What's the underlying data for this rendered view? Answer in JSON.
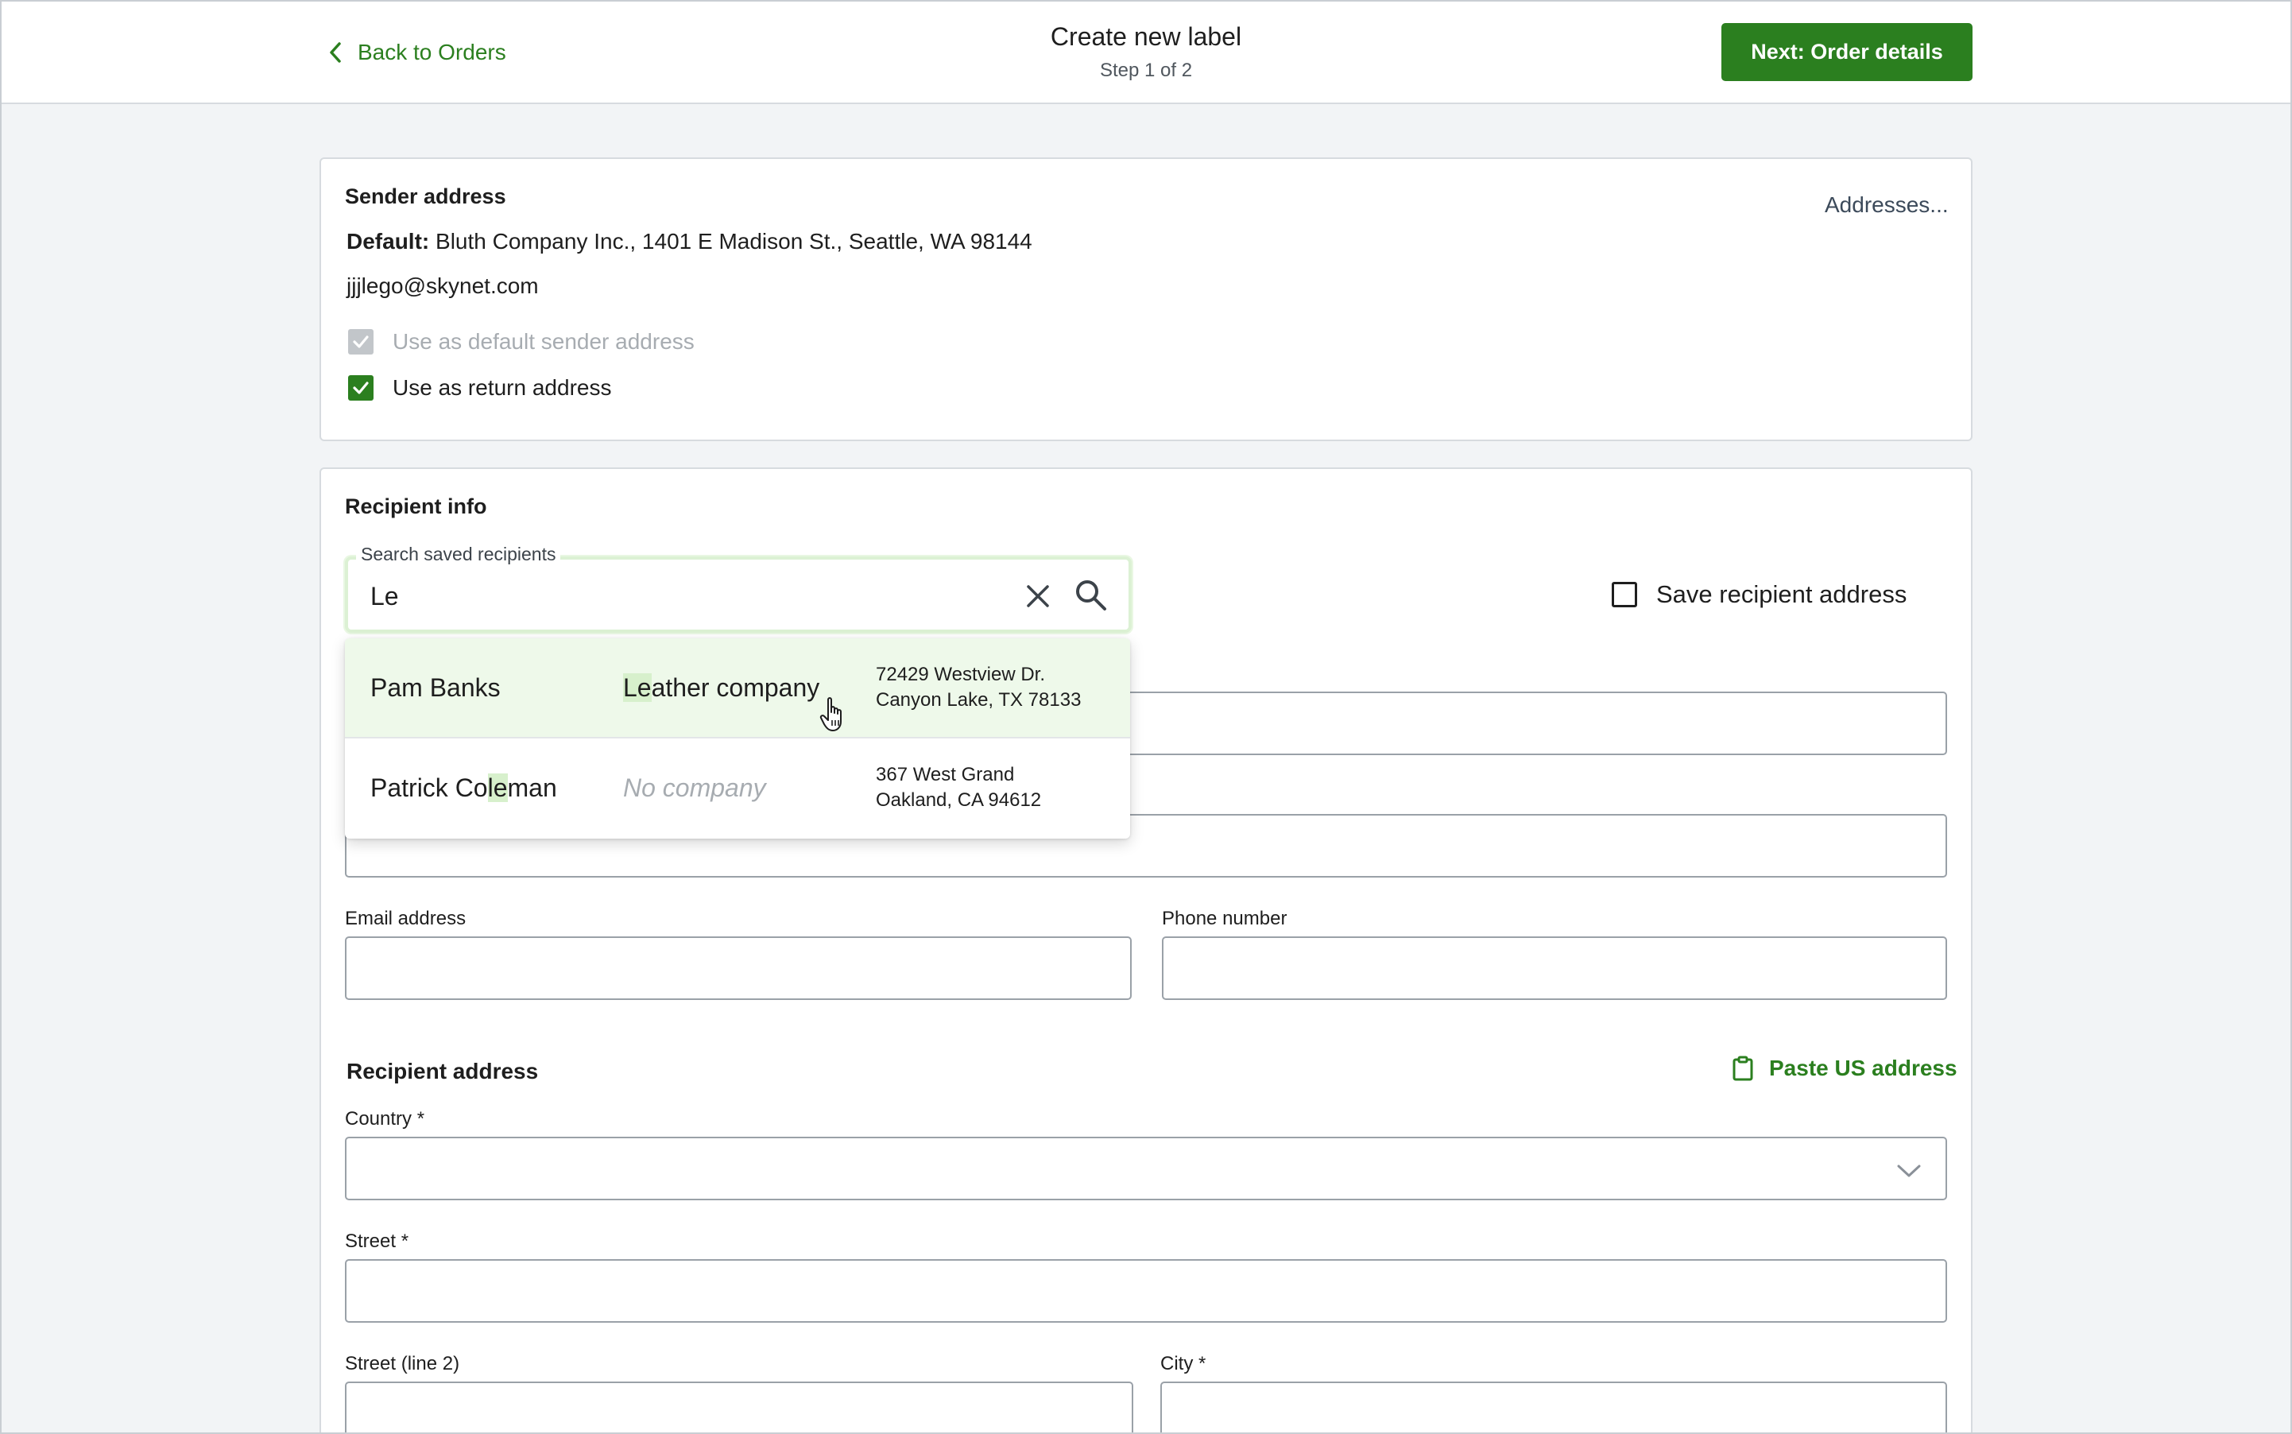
{
  "header": {
    "back_label": "Back to Orders",
    "title": "Create new label",
    "subtitle": "Step 1 of 2",
    "next_label": "Next: Order details"
  },
  "sender": {
    "heading": "Sender address",
    "addresses_link": "Addresses...",
    "default_prefix": "Default:",
    "default_address": "Bluth Company Inc., 1401 E Madison St., Seattle, WA 98144",
    "email": "jjjlego@skynet.com",
    "default_sender_label": "Use as default sender address",
    "default_sender_checked": true,
    "return_address_label": "Use as return address",
    "return_address_checked": true
  },
  "recipient": {
    "heading": "Recipient info",
    "search": {
      "label": "Search saved recipients",
      "value": "Le"
    },
    "save_recipient_label": "Save recipient address",
    "save_recipient_checked": false,
    "results": [
      {
        "name": "Pam Banks",
        "company_match": "Le",
        "company_rest": "ather company",
        "address_line1": "72429 Westview Dr.",
        "address_line2": "Canyon Lake, TX 78133"
      },
      {
        "name_before": "Patrick Co",
        "name_match": "le",
        "name_after": "man",
        "company": "No company",
        "address_line1": "367 West Grand",
        "address_line2": "Oakland, CA 94612"
      }
    ],
    "email_label": "Email address",
    "phone_label": "Phone number"
  },
  "recipient_address": {
    "heading": "Recipient address",
    "paste_label": "Paste US address",
    "country_label": "Country *",
    "street_label": "Street *",
    "street2_label": "Street (line 2)",
    "city_label": "City *"
  },
  "colors": {
    "brand_green": "#2b7f1f",
    "highlight": "#d7f0cc",
    "active_row": "#eef9ea"
  }
}
